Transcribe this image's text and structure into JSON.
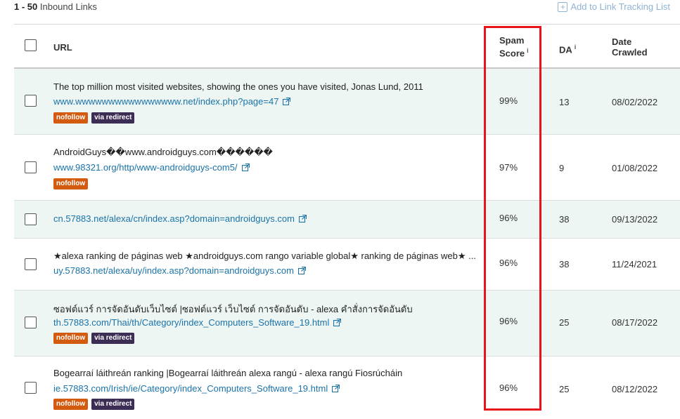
{
  "header": {
    "range": "1 - 50",
    "label": "Inbound Links",
    "add_tracking": "Add to Link Tracking List"
  },
  "columns": {
    "url": "URL",
    "spam_line1": "Spam",
    "spam_line2": "Score",
    "spam_info": "i",
    "da": "DA",
    "da_info": "i",
    "date_line1": "Date",
    "date_line2": "Crawled"
  },
  "rows": [
    {
      "title": "The top million most visited websites, showing the ones you have visited, Jonas Lund, 2011",
      "url": "www.wwwwwwwwwwwwwwww.net/index.php?page=47",
      "tags": [
        "nofollow",
        "via redirect"
      ],
      "spam": "99%",
      "da": "13",
      "date": "08/02/2022"
    },
    {
      "title": "AndroidGuys��www.androidguys.com������",
      "url": "www.98321.org/http/www-androidguys-com5/",
      "tags": [
        "nofollow"
      ],
      "spam": "97%",
      "da": "9",
      "date": "01/08/2022"
    },
    {
      "title": "",
      "url": "cn.57883.net/alexa/cn/index.asp?domain=androidguys.com",
      "tags": [],
      "spam": "96%",
      "da": "38",
      "date": "09/13/2022"
    },
    {
      "title": "★alexa ranking de páginas web ★androidguys.com rango variable global★ ranking de páginas web★ ...",
      "url": "uy.57883.net/alexa/uy/index.asp?domain=androidguys.com",
      "tags": [],
      "spam": "96%",
      "da": "38",
      "date": "11/24/2021"
    },
    {
      "title": "ซอฟต์แวร์ การจัดอันดับเว็บไซต์ |ซอฟต์แวร์ เว็บไซต์ การจัดอันดับ - alexa คำสั่งการจัดอันดับ",
      "url": "th.57883.com/Thai/th/Category/index_Computers_Software_19.html",
      "tags": [
        "nofollow",
        "via redirect"
      ],
      "spam": "96%",
      "da": "25",
      "date": "08/17/2022"
    },
    {
      "title": "Bogearraí láithreán ranking |Bogearraí láithreán alexa rangú - alexa rangú Fiosrúcháin",
      "url": "ie.57883.com/Irish/ie/Category/index_Computers_Software_19.html",
      "tags": [
        "nofollow",
        "via redirect"
      ],
      "spam": "96%",
      "da": "25",
      "date": "08/12/2022"
    }
  ],
  "colors": {
    "highlight": "#e8141b",
    "link": "#1a73a8",
    "nofollow": "#d35b10",
    "redirect": "#3c2d55",
    "row_shade": "#eef6f4"
  }
}
